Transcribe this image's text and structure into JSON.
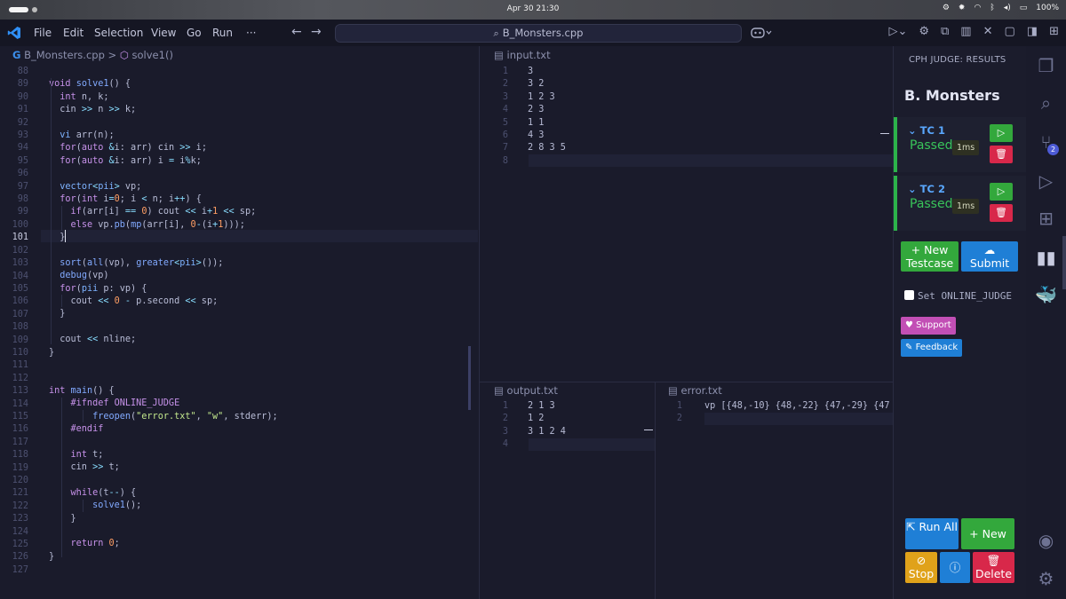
{
  "os": {
    "clock": "Apr 30  21:30",
    "battery": "100%"
  },
  "menu": [
    "File",
    "Edit",
    "Selection",
    "View",
    "Go",
    "Run",
    "···"
  ],
  "command_center": "B_Monsters.cpp",
  "editor": {
    "breadcrumb_file": "B_Monsters.cpp",
    "breadcrumb_sep": ">",
    "breadcrumb_symbol": "solve1()",
    "current_line": "101",
    "line_numbers": [
      "88",
      "89",
      "90",
      "91",
      "92",
      "93",
      "94",
      "95",
      "96",
      "97",
      "98",
      "99",
      "100",
      "101",
      "102",
      "103",
      "104",
      "105",
      "106",
      "107",
      "108",
      "109",
      "110",
      "111",
      "112",
      "113",
      "114",
      "115",
      "116",
      "117",
      "118",
      "119",
      "120",
      "121",
      "122",
      "123",
      "124",
      "125",
      "126",
      "127"
    ],
    "lines": [
      "",
      "void solve1() {",
      "  int n, k;",
      "  cin >> n >> k;",
      "",
      "  vi arr(n);",
      "  for(auto &i: arr) cin >> i;",
      "  for(auto &i: arr) i = i%k;",
      "",
      "  vector<pii> vp;",
      "  for(int i=0; i < n; i++) {",
      "    if(arr[i] == 0) cout << i+1 << sp;",
      "    else vp.pb(mp(arr[i], 0-(i+1)));",
      "  }",
      "",
      "  sort(all(vp), greater<pii>());",
      "  debug(vp)",
      "  for(pii p: vp) {",
      "    cout << 0 - p.second << sp;",
      "  }",
      "",
      "  cout << nline;",
      "}",
      "",
      "",
      "int main() {",
      "    #ifndef ONLINE_JUDGE",
      "        freopen(\"error.txt\", \"w\", stderr);",
      "    #endif",
      "",
      "    int t;",
      "    cin >> t;",
      "",
      "    while(t--) {",
      "        solve1();",
      "    }",
      "",
      "    return 0;",
      "}",
      ""
    ]
  },
  "input_pane": {
    "title": "input.txt",
    "line_numbers": [
      "1",
      "2",
      "3",
      "4",
      "5",
      "6",
      "7",
      "8"
    ],
    "lines": [
      "3",
      "3 2",
      "1 2 3",
      "2 3",
      "1 1",
      "4 3",
      "2 8 3 5",
      ""
    ]
  },
  "output_pane": {
    "title": "output.txt",
    "line_numbers": [
      "1",
      "2",
      "3",
      "4"
    ],
    "lines": [
      "2 1 3",
      "1 2",
      "3 1 2 4",
      ""
    ]
  },
  "error_pane": {
    "title": "error.txt",
    "line_numbers": [
      "1",
      "2"
    ],
    "lines": [
      "vp [{48,-10} {48,-22} {47,-29} {47,-",
      ""
    ]
  },
  "cph": {
    "header": "CPH JUDGE: RESULTS",
    "problem": "B. Monsters",
    "testcases": [
      {
        "name": "TC 1",
        "status": "Passed",
        "time": "1ms"
      },
      {
        "name": "TC 2",
        "status": "Passed",
        "time": "1ms"
      }
    ],
    "new_testcase": "New Testcase",
    "new_plus": "+",
    "submit": "Submit",
    "set_online_judge": "Set ONLINE_JUDGE",
    "support": "Support",
    "feedback": "Feedback",
    "run_all": "Run All",
    "new": "New",
    "stop": "Stop",
    "delete": "Delete"
  },
  "activity": {
    "source_control_badge": "2"
  },
  "colors": {
    "passed": "#39c45a",
    "run_button": "#33a83c",
    "delete_button": "#d8284a",
    "submit_button": "#1f7fd6",
    "stop_button": "#e0a21a",
    "support_button": "#c24fb5",
    "accent_blue": "#5aa8ff"
  }
}
